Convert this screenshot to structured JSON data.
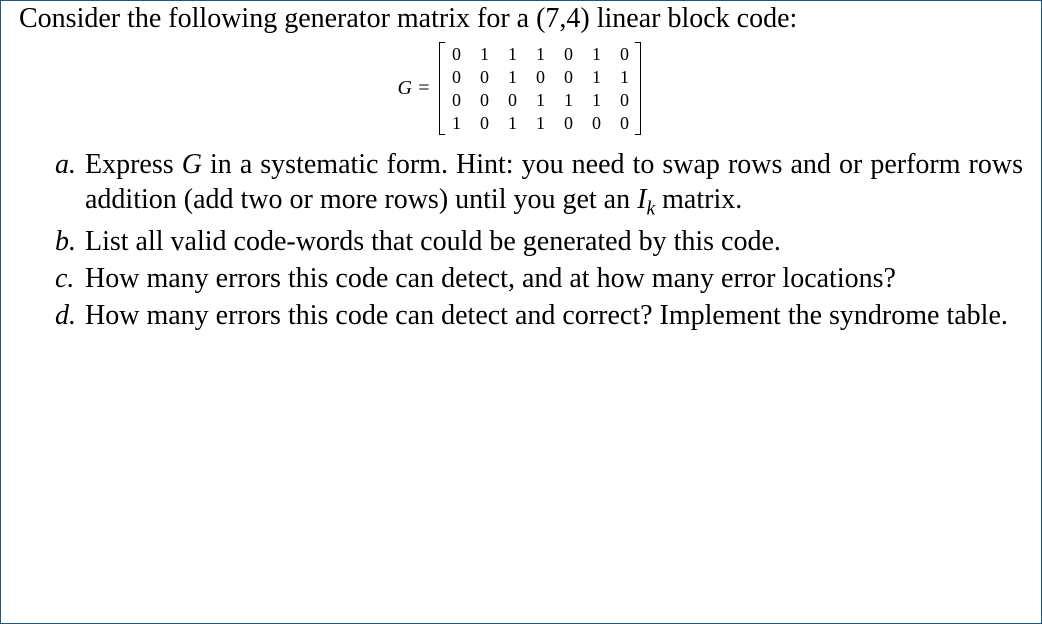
{
  "intro": "Consider the following generator matrix for a (7,4) linear block code:",
  "matrix": {
    "label": "G =",
    "rows": [
      [
        "0",
        "1",
        "1",
        "1",
        "0",
        "1",
        "0"
      ],
      [
        "0",
        "0",
        "1",
        "0",
        "0",
        "1",
        "1"
      ],
      [
        "0",
        "0",
        "0",
        "1",
        "1",
        "1",
        "0"
      ],
      [
        "1",
        "0",
        "1",
        "1",
        "0",
        "0",
        "0"
      ]
    ]
  },
  "problems": {
    "a": {
      "marker": "a.",
      "pre": "Express ",
      "var": "G",
      "mid": " in a systematic form. Hint: you need to swap rows and or perform rows addition (add two or more rows) until you get an ",
      "ik_I": "I",
      "ik_k": "k",
      "post": " matrix."
    },
    "b": {
      "marker": "b.",
      "text": "List all valid code-words that could be generated by this code."
    },
    "c": {
      "marker": "c.",
      "text": "How many errors this code can detect, and at how many error locations?"
    },
    "d": {
      "marker": "d.",
      "text": "How many errors this code can detect and correct? Implement the syndrome table."
    }
  }
}
